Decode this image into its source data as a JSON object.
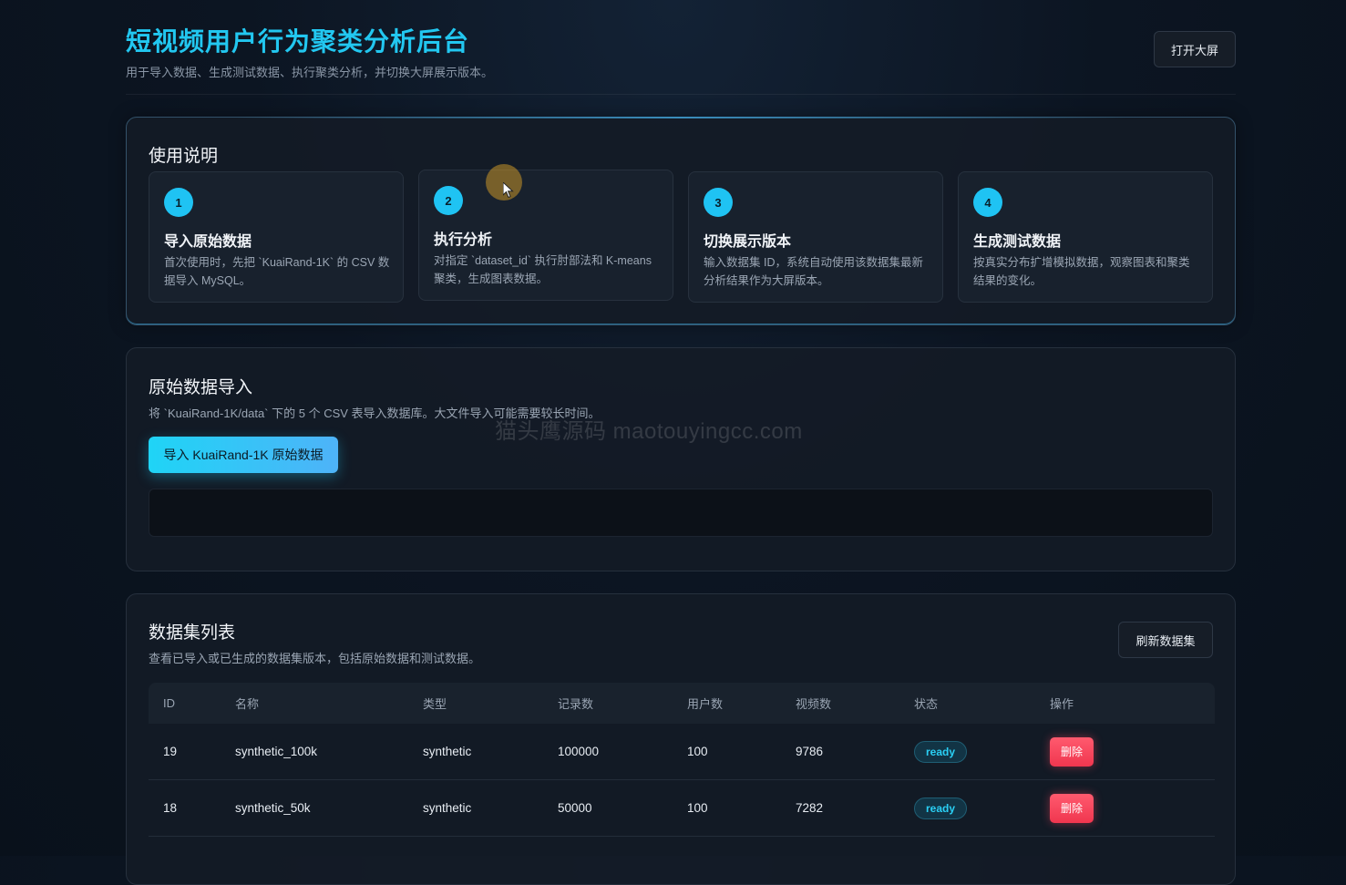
{
  "header": {
    "title": "短视频用户行为聚类分析后台",
    "subtitle": "用于导入数据、生成测试数据、执行聚类分析，并切换大屏展示版本。",
    "open_screen_label": "打开大屏"
  },
  "guide": {
    "title": "使用说明",
    "steps": [
      {
        "num": "1",
        "title": "导入原始数据",
        "desc": "首次使用时，先把 `KuaiRand-1K` 的 CSV 数据导入 MySQL。"
      },
      {
        "num": "2",
        "title": "执行分析",
        "desc": "对指定 `dataset_id` 执行肘部法和 K-means 聚类，生成图表数据。"
      },
      {
        "num": "3",
        "title": "切换展示版本",
        "desc": "输入数据集 ID，系统自动使用该数据集最新分析结果作为大屏版本。"
      },
      {
        "num": "4",
        "title": "生成测试数据",
        "desc": "按真实分布扩增模拟数据，观察图表和聚类结果的变化。"
      }
    ]
  },
  "import": {
    "title": "原始数据导入",
    "desc": "将 `KuaiRand-1K/data` 下的 5 个 CSV 表导入数据库。大文件导入可能需要较长时间。",
    "button_label": "导入 KuaiRand-1K 原始数据",
    "log_text": ""
  },
  "datasets": {
    "title": "数据集列表",
    "desc": "查看已导入或已生成的数据集版本，包括原始数据和测试数据。",
    "refresh_label": "刷新数据集",
    "columns": [
      "ID",
      "名称",
      "类型",
      "记录数",
      "用户数",
      "视频数",
      "状态",
      "操作"
    ],
    "rows": [
      {
        "id": "19",
        "name": "synthetic_100k",
        "type": "synthetic",
        "records": "100000",
        "users": "100",
        "videos": "9786",
        "status": "ready",
        "action": "删除"
      },
      {
        "id": "18",
        "name": "synthetic_50k",
        "type": "synthetic",
        "records": "50000",
        "users": "100",
        "videos": "7282",
        "status": "ready",
        "action": "删除"
      }
    ]
  },
  "watermark": "猫头鹰源码 maotouyingcc.com",
  "colors": {
    "accent": "#22c7f0",
    "danger": "#f0364f",
    "background": "#0c1522"
  }
}
